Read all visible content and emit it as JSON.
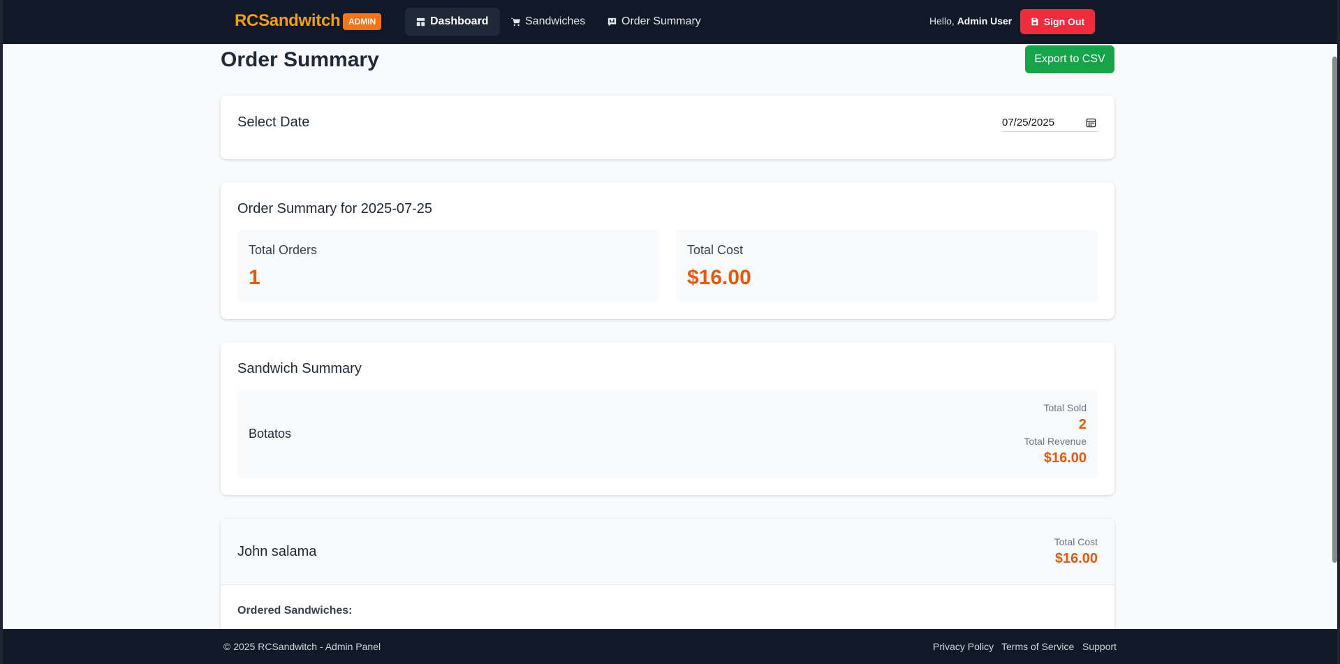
{
  "navbar": {
    "brand": "RCSandwitch",
    "badge": "ADMIN",
    "links": [
      {
        "label": "Dashboard",
        "icon": "dashboard-icon"
      },
      {
        "label": "Sandwiches",
        "icon": "cart-icon"
      },
      {
        "label": "Order Summary",
        "icon": "summary-icon"
      }
    ],
    "greeting_prefix": "Hello,",
    "user_name": "Admin User",
    "sign_out": "Sign Out"
  },
  "page": {
    "title": "Order Summary",
    "export_label": "Export to CSV"
  },
  "date_picker": {
    "title": "Select Date",
    "value": "07/25/2025"
  },
  "summary": {
    "title": "Order Summary for 2025-07-25",
    "total_orders_label": "Total Orders",
    "total_orders_value": "1",
    "total_cost_label": "Total Cost",
    "total_cost_value": "$16.00"
  },
  "sandwich_summary": {
    "title": "Sandwich Summary",
    "items": [
      {
        "name": "Botatos",
        "sold_label": "Total Sold",
        "sold_value": "2",
        "revenue_label": "Total Revenue",
        "revenue_value": "$16.00"
      }
    ]
  },
  "orders": [
    {
      "customer": "John salama",
      "cost_label": "Total Cost",
      "cost_value": "$16.00",
      "ordered_label": "Ordered Sandwiches:"
    }
  ],
  "footer": {
    "copyright": "© 2025 RCSandwitch - Admin Panel",
    "links": [
      "Privacy Policy",
      "Terms of Service",
      "Support"
    ]
  },
  "colors": {
    "accent": "#f59e0b",
    "value": "#ea580c",
    "signout": "#ef2b3d",
    "export": "#16a34a",
    "nav_bg": "#111827"
  }
}
